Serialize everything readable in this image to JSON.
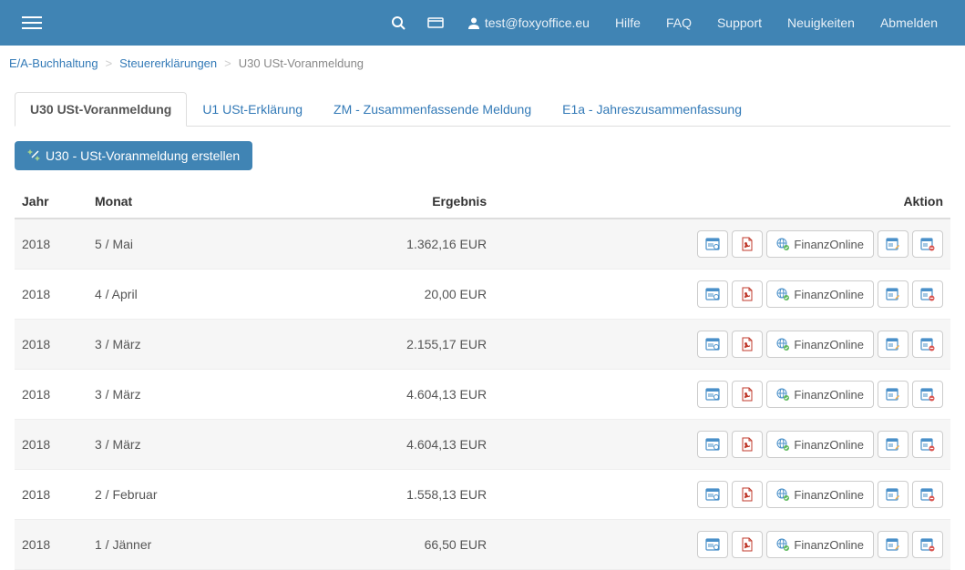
{
  "topbar": {
    "user_email": "test@foxyoffice.eu",
    "links": {
      "help": "Hilfe",
      "faq": "FAQ",
      "support": "Support",
      "news": "Neuigkeiten",
      "logout": "Abmelden"
    }
  },
  "breadcrumb": {
    "items": [
      "E/A-Buchhaltung",
      "Steuererklärungen",
      "U30 USt-Voranmeldung"
    ]
  },
  "tabs": {
    "items": [
      "U30 USt-Voranmeldung",
      "U1 USt-Erklärung",
      "ZM - Zusammenfassende Meldung",
      "E1a - Jahreszusammenfassung"
    ]
  },
  "create_button": "U30 - USt-Voranmeldung erstellen",
  "table": {
    "headers": {
      "year": "Jahr",
      "month": "Monat",
      "result": "Ergebnis",
      "action": "Aktion"
    },
    "finanzonline_label": "FinanzOnline",
    "rows": [
      {
        "year": "2018",
        "month": "5 / Mai",
        "result": "1.362,16 EUR"
      },
      {
        "year": "2018",
        "month": "4 / April",
        "result": "20,00 EUR"
      },
      {
        "year": "2018",
        "month": "3 / März",
        "result": "2.155,17 EUR"
      },
      {
        "year": "2018",
        "month": "3 / März",
        "result": "4.604,13 EUR"
      },
      {
        "year": "2018",
        "month": "3 / März",
        "result": "4.604,13 EUR"
      },
      {
        "year": "2018",
        "month": "2 / Februar",
        "result": "1.558,13 EUR"
      },
      {
        "year": "2018",
        "month": "1 / Jänner",
        "result": "66,50 EUR"
      }
    ]
  }
}
